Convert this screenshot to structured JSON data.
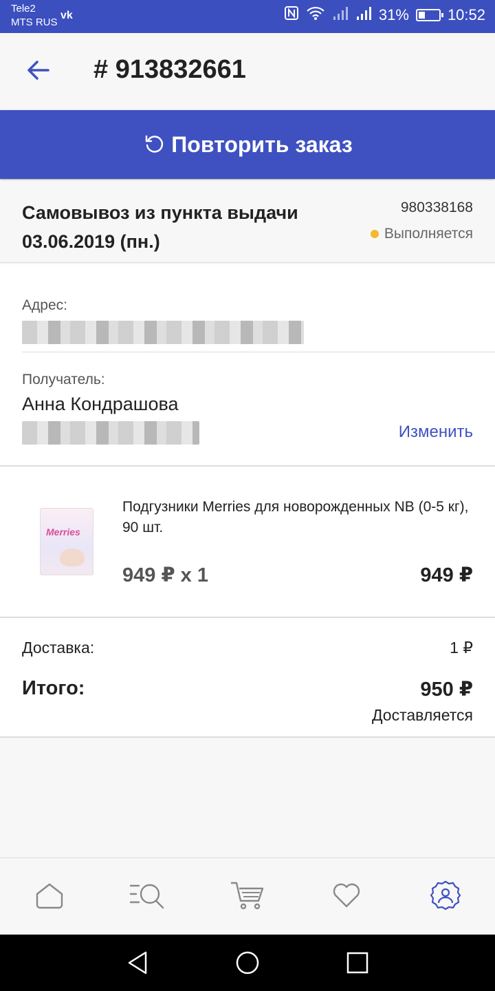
{
  "status_bar": {
    "carrier_1": "Tele2",
    "carrier_2": "MTS RUS",
    "battery_percent": "31%",
    "battery_level": 0.31,
    "time": "10:52"
  },
  "header": {
    "title": "# 913832661"
  },
  "repeat_order": {
    "label": "Повторить заказ"
  },
  "delivery": {
    "title": "Самовывоз из пункта выдачи 03.06.2019 (пн.)",
    "id": "980338168",
    "status": "Выполняется"
  },
  "address": {
    "label": "Адрес:"
  },
  "recipient": {
    "label": "Получатель:",
    "name": "Анна Кондрашова",
    "edit_label": "Изменить"
  },
  "product": {
    "name": "Подгузники Merries для новорожденных NB (0-5 кг), 90 шт.",
    "image_brand": "Merries",
    "price_qty": "949 ₽ x 1",
    "total": "949 ₽"
  },
  "summary": {
    "shipping_label": "Доставка:",
    "shipping_value": "1 ₽",
    "total_label": "Итого:",
    "total_value": "950 ₽",
    "total_status": "Доставляется"
  },
  "bottom_nav": {
    "items": [
      "home-icon",
      "catalog-search-icon",
      "cart-icon",
      "favorites-icon",
      "settings-icon"
    ],
    "active": "settings-icon"
  },
  "colors": {
    "accent": "#3f51c1",
    "status_dot": "#f5b82e"
  }
}
